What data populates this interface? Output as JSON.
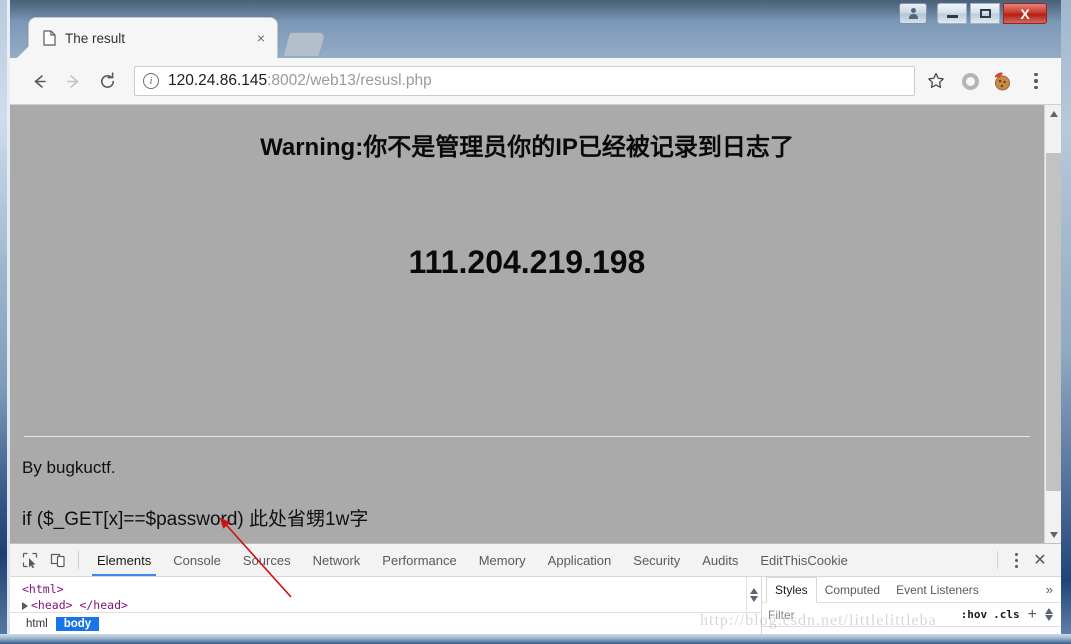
{
  "window": {
    "controls": {
      "user_label": "user-account",
      "minimize_label": "Minimize",
      "maximize_label": "Maximize",
      "close_label": "X"
    }
  },
  "tab": {
    "title": "The result",
    "close_label": "×",
    "favicon": "page-icon",
    "newtab_label": "New tab"
  },
  "toolbar": {
    "back_label": "←",
    "forward_label": "→",
    "reload_label": "⟳",
    "url_host": "120.24.86.145",
    "url_path": ":8002/web13/resusl.php",
    "url_full": "120.24.86.145:8002/web13/resusl.php",
    "info_icon": "ⓘ",
    "star_label": "☆",
    "extension_icon": "gray-circle-extension",
    "cookie_extension_icon": "edit-this-cookie-santa-cookie",
    "menu_label": "Customize and control Google Chrome"
  },
  "page": {
    "background": "#aaaaaa",
    "warning_heading": "Warning:你不是管理员你的IP已经被记录到日志了",
    "ip_address": "111.204.219.198",
    "byline": "By bugkuctf.",
    "code_line": "if ($_GET[x]==$password) 此处省甥1w字"
  },
  "devtools": {
    "tabs": [
      {
        "label": "Elements",
        "active": true
      },
      {
        "label": "Console",
        "active": false
      },
      {
        "label": "Sources",
        "active": false
      },
      {
        "label": "Network",
        "active": false
      },
      {
        "label": "Performance",
        "active": false
      },
      {
        "label": "Memory",
        "active": false
      },
      {
        "label": "Application",
        "active": false
      },
      {
        "label": "Security",
        "active": false
      },
      {
        "label": "Audits",
        "active": false
      },
      {
        "label": "EditThisCookie",
        "active": false
      }
    ],
    "inspect_icon": "inspect-element-icon",
    "device_icon": "device-toolbar-icon",
    "close_label": "✕",
    "dom": {
      "line1": "<html>",
      "line2": "<head> </head>"
    },
    "breadcrumb": [
      {
        "label": "html",
        "selected": false
      },
      {
        "label": "body",
        "selected": true
      }
    ],
    "styles_panel": {
      "tabs": [
        {
          "label": "Styles",
          "active": true
        },
        {
          "label": "Computed",
          "active": false
        },
        {
          "label": "Event Listeners",
          "active": false
        }
      ],
      "more_label": "»",
      "filter_placeholder": "Filter",
      "hov_label": ":hov",
      "cls_label": ".cls",
      "plus_label": "+"
    }
  },
  "watermark": {
    "text": "http://blog.csdn.net/littlelittleba"
  },
  "colors": {
    "page_bg": "#aaaaaa",
    "accent_blue": "#4285f4",
    "breadcrumb_sel": "#1a73e8",
    "annotation_red": "#d01010",
    "close_red": "#c9392c"
  }
}
